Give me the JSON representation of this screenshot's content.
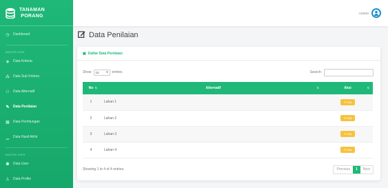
{
  "app": {
    "title_line1": "TANAMAN",
    "title_line2": "PORANG"
  },
  "sidebar": {
    "dashboard": "Dashboard",
    "section_master": "MASTER DATA",
    "items": [
      {
        "label": "Data Kriteria",
        "icon": "cube-icon"
      },
      {
        "label": "Data Sub Kriteria",
        "icon": "cubes-icon"
      },
      {
        "label": "Data Alternatif",
        "icon": "users-icon"
      },
      {
        "label": "Data Penilaian",
        "icon": "edit-icon",
        "active": true
      },
      {
        "label": "Data Perhitungan",
        "icon": "calculator-icon"
      },
      {
        "label": "Data Hasil Akhir",
        "icon": "chart-icon"
      }
    ],
    "section_user": "MASTER USER",
    "user_items": [
      {
        "label": "Data User",
        "icon": "user-icon"
      },
      {
        "label": "Data Profile",
        "icon": "profile-icon"
      }
    ]
  },
  "topbar": {
    "user_label": "ADMIN"
  },
  "page": {
    "title": "Data Penilaian"
  },
  "card": {
    "header": "Daftar Data Penilaian",
    "show_label": "Show",
    "entries_value": "10",
    "entries_label": "entries",
    "search_label": "Search:",
    "search_value": "",
    "columns": {
      "no": "No",
      "alternatif": "Alternatif",
      "aksi": "Aksi"
    },
    "rows": [
      {
        "no": "1",
        "alternatif": "Lahan 1",
        "action": "Edit"
      },
      {
        "no": "2",
        "alternatif": "Lahan 2",
        "action": "Edit"
      },
      {
        "no": "3",
        "alternatif": "Lahan 3",
        "action": "Edit"
      },
      {
        "no": "4",
        "alternatif": "Lahan 4",
        "action": "Edit"
      }
    ],
    "info": "Showing 1 to 4 of 4 entries",
    "pagination": {
      "previous": "Previous",
      "current": "1",
      "next": "Next"
    }
  },
  "colors": {
    "primary": "#1fb878",
    "warning": "#f6c23e",
    "avatar_border": "#1f8ec7"
  }
}
